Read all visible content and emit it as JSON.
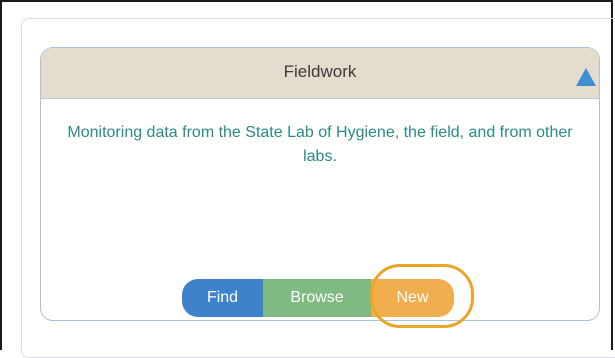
{
  "panel": {
    "title": "Fieldwork",
    "description": "Monitoring data from the State Lab of Hygiene, the field, and from other labs.",
    "collapse_icon": "triangle-up-icon",
    "header_color": "#e4ddce",
    "description_color": "#2b8a85"
  },
  "actions": {
    "find_label": "Find",
    "browse_label": "Browse",
    "new_label": "New",
    "find_color": "#3f82cc",
    "browse_color": "#7fba82",
    "new_color": "#f0ae4e",
    "highlight_color": "#e9a526"
  }
}
